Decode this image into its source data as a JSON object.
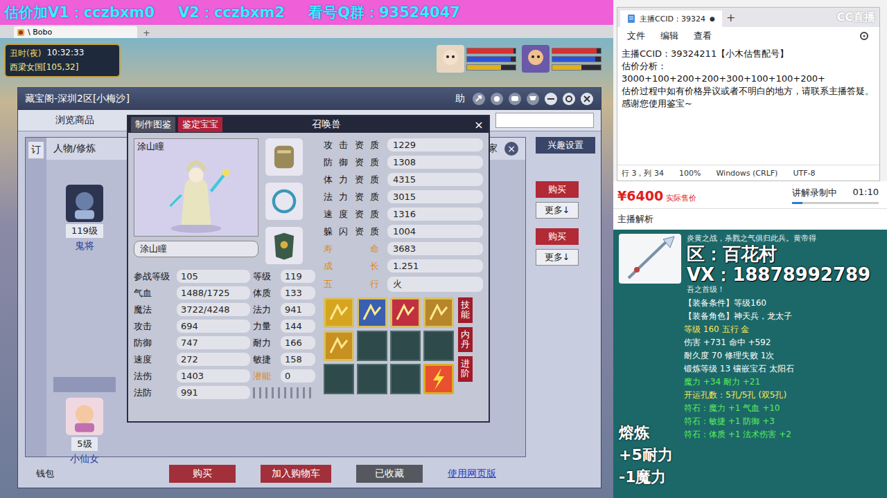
{
  "banner": {
    "segments": [
      "估价加V1：cczbxm0",
      "V2：cczbxm2",
      "看号Q群：93524047"
    ]
  },
  "browser": {
    "tab_label": "\\ Bobo",
    "new_tab": "+"
  },
  "game_header": {
    "time_label": "丑时(夜)",
    "clock": "10:32:33",
    "location": "西梁女国[105,32]"
  },
  "party": [
    {
      "bars": [
        {
          "level": 0.95,
          "color": "#d83030"
        },
        {
          "level": 0.9,
          "color": "#3050d8"
        },
        {
          "level": 0.7,
          "color": "#e0b020"
        }
      ]
    },
    {
      "bars": [
        {
          "level": 0.92,
          "color": "#d83030"
        },
        {
          "level": 0.88,
          "color": "#3050d8"
        },
        {
          "level": 0.6,
          "color": "#e0b020"
        }
      ]
    }
  ],
  "market_window": {
    "title": "藏宝阁-深圳2区[小梅沙]",
    "help_label": "助",
    "tabs": [
      {
        "label": "浏览商品",
        "selected": false
      }
    ],
    "interest_button": "兴趣设置",
    "sub_tab": "订",
    "category": "人物/修炼",
    "sub_close": "×",
    "edge_text": "家",
    "list": [
      {
        "level": "119级",
        "name": "鬼将"
      },
      {
        "level": "5级",
        "name": "小仙女"
      }
    ],
    "row_buttons": [
      {
        "buy": "购买",
        "more": "更多↓"
      },
      {
        "buy": "购买",
        "more": "更多↓"
      }
    ],
    "wallet": "钱包",
    "footer_buttons": [
      {
        "label": "购买",
        "kind": "buy"
      },
      {
        "label": "加入购物车",
        "kind": "buy"
      },
      {
        "label": "已收藏",
        "kind": "done"
      }
    ],
    "web_link": "使用网页版"
  },
  "pet_window": {
    "title": "召唤兽",
    "close": "×",
    "tabs": [
      {
        "label": "制作图鉴",
        "selected": false
      },
      {
        "label": "鉴定宝宝",
        "selected": true
      }
    ],
    "name_caption": "涂山瞳",
    "name_field": "涂山瞳",
    "attributes": [
      {
        "label": "攻击资质",
        "value": "1229",
        "highlight": false
      },
      {
        "label": "防御资质",
        "value": "1308",
        "highlight": false
      },
      {
        "label": "体力资质",
        "value": "4315",
        "highlight": false
      },
      {
        "label": "法力资质",
        "value": "3015",
        "highlight": false
      },
      {
        "label": "速度资质",
        "value": "1316",
        "highlight": false
      },
      {
        "label": "躲闪资质",
        "value": "1004",
        "highlight": false
      },
      {
        "label": "寿命",
        "value": "3683",
        "highlight": true
      },
      {
        "label": "成长",
        "value": "1.251",
        "highlight": true
      },
      {
        "label": "五行",
        "value": "火",
        "highlight": true
      }
    ],
    "stats": [
      {
        "label": "参战等级",
        "value": "105",
        "highlight": false
      },
      {
        "label": "等级",
        "value": "119",
        "highlight": false
      },
      {
        "label": "气血",
        "value": "1488/1725",
        "highlight": false
      },
      {
        "label": "体质",
        "value": "133",
        "highlight": false
      },
      {
        "label": "魔法",
        "value": "3722/4248",
        "highlight": false
      },
      {
        "label": "法力",
        "value": "941",
        "highlight": false
      },
      {
        "label": "攻击",
        "value": "694",
        "highlight": false
      },
      {
        "label": "力量",
        "value": "144",
        "highlight": false
      },
      {
        "label": "防御",
        "value": "747",
        "highlight": false
      },
      {
        "label": "耐力",
        "value": "166",
        "highlight": false
      },
      {
        "label": "速度",
        "value": "272",
        "highlight": false
      },
      {
        "label": "敏捷",
        "value": "158",
        "highlight": false
      },
      {
        "label": "法伤",
        "value": "1403",
        "highlight": false
      },
      {
        "label": "潜能",
        "value": "0",
        "highlight": true
      },
      {
        "label": "法防",
        "value": "991",
        "highlight": false
      }
    ],
    "skills": [
      {
        "kind": "skill",
        "color": "#d6a520"
      },
      {
        "kind": "skill",
        "color": "#3a5fb0"
      },
      {
        "kind": "skill",
        "color": "#c03040"
      },
      {
        "kind": "skill",
        "color": "#b8862a"
      },
      {
        "kind": "skill",
        "color": "#c89020"
      },
      {
        "kind": "empty",
        "color": "#2f4a4a"
      },
      {
        "kind": "empty",
        "color": "#2f4a4a"
      },
      {
        "kind": "empty",
        "color": "#2f4a4a"
      },
      {
        "kind": "empty",
        "color": "#2f4a4a"
      },
      {
        "kind": "empty",
        "color": "#2f4a4a"
      },
      {
        "kind": "empty",
        "color": "#2f4a4a"
      },
      {
        "kind": "special",
        "color": "#d9b020"
      }
    ],
    "side_buttons": [
      "技能",
      "内丹",
      "进阶"
    ]
  },
  "notepad": {
    "tab_title": "主播CCID：39324",
    "modified_mark": "●",
    "new_tab": "+",
    "watermark": "CC直播",
    "menus": [
      "文件",
      "编辑",
      "查看"
    ],
    "lines": [
      "主播CCID：39324211【小木估售配号】",
      "估价分析：",
      "3000+100+200+200+300+100+100+200+",
      "估价过程中如有价格异议或者不明白的地方，请联系主播答疑。感谢您使用鉴宝~"
    ],
    "status": [
      "行 3，列 34",
      "100%",
      "Windows (CRLF)",
      "UTF-8"
    ]
  },
  "price": {
    "amount": "¥6400",
    "label": "实际售价",
    "recording": "讲解录制中",
    "timer": "01:10",
    "level": 0.12
  },
  "analysis_title": "主播解析",
  "tooltip": {
    "lore": [
      "炎黄之战，杀戮之气俱归此兵。黄帝得",
      "吾之首级！"
    ],
    "overlay": [
      "区：百花村",
      "VX：18878992789"
    ],
    "lines": [
      {
        "text": "【装备条件】等级160",
        "color": "#ffffff"
      },
      {
        "text": "【装备角色】神天兵，龙太子",
        "color": "#ffffff"
      },
      {
        "text": "等级 160 五行 金",
        "color": "#ffe95a"
      },
      {
        "text": "伤害 +731 命中 +592",
        "color": "#ffffff"
      },
      {
        "text": "耐久度 70 修理失败 1次",
        "color": "#ffffff"
      },
      {
        "text": "锻炼等级 13 镶嵌宝石 太阳石",
        "color": "#ffffff"
      },
      {
        "text": "魔力 +34 耐力 +21",
        "color": "#5af05a"
      },
      {
        "text": "开运孔数：5孔/5孔 (双5孔)",
        "color": "#ffe95a"
      },
      {
        "text": "符石：魔力 +1 气血 +10",
        "color": "#5af05a"
      },
      {
        "text": "符石：敏捷 +1 防御 +3",
        "color": "#5af05a"
      },
      {
        "text": "符石：体质 +1 法术伤害 +2",
        "color": "#5af05a"
      }
    ],
    "melt": [
      "熔炼",
      "+5耐力",
      "-1魔力"
    ]
  }
}
